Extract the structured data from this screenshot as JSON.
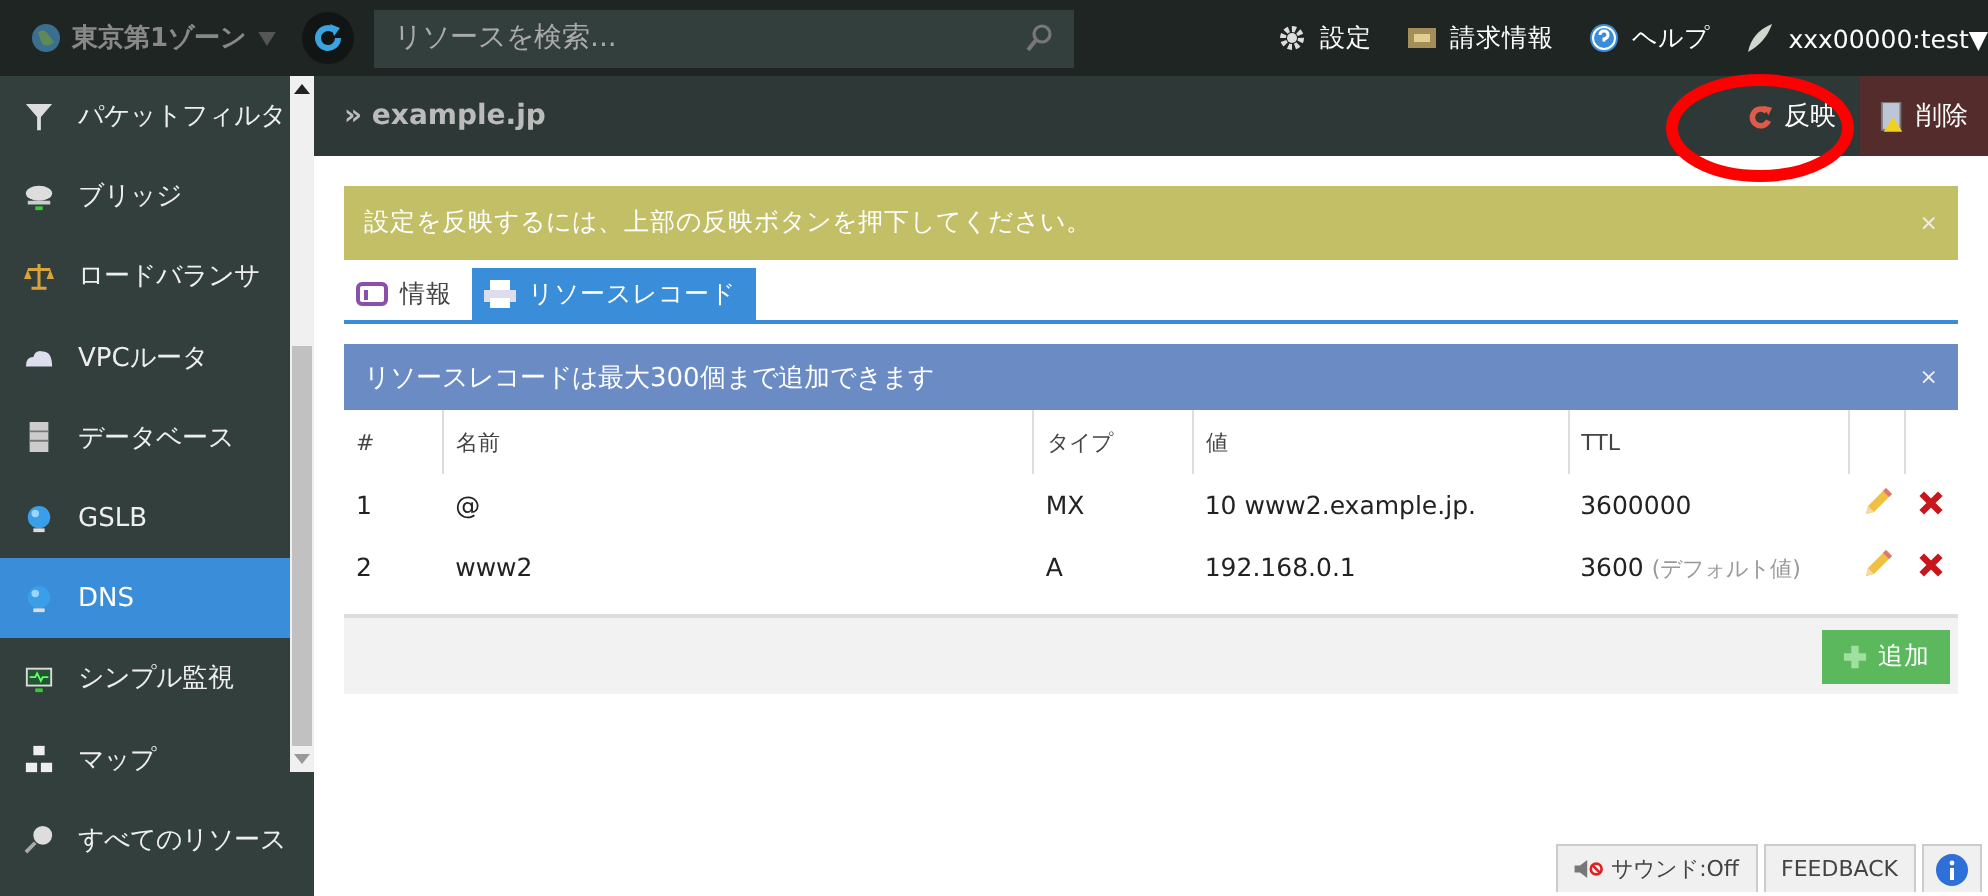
{
  "topbar": {
    "zone": "東京第1ゾーン",
    "search": {
      "placeholder": "リソースを検索..."
    },
    "links": [
      {
        "kind": "gear",
        "label": "設定"
      },
      {
        "kind": "bill",
        "label": "請求情報"
      },
      {
        "kind": "help",
        "label": "ヘルプ"
      },
      {
        "kind": "user",
        "label": "xxx00000:test▼"
      }
    ]
  },
  "sidebar": {
    "items": [
      {
        "kind": "filter",
        "label": "パケットフィルタ",
        "selected": false
      },
      {
        "kind": "bridge",
        "label": "ブリッジ",
        "selected": false
      },
      {
        "kind": "scale",
        "label": "ロードバランサ",
        "selected": false
      },
      {
        "kind": "cloud",
        "label": "VPCルータ",
        "selected": false
      },
      {
        "kind": "db",
        "label": "データベース",
        "selected": false
      },
      {
        "kind": "globe",
        "label": "GSLB",
        "selected": false
      },
      {
        "kind": "globe",
        "label": "DNS",
        "selected": true
      },
      {
        "kind": "monitor",
        "label": "シンプル監視",
        "selected": false
      },
      {
        "kind": "map",
        "label": "マップ",
        "selected": false
      },
      {
        "kind": "search",
        "label": "すべてのリソース",
        "selected": false
      }
    ]
  },
  "header": {
    "breadcrumb": "» example.jp",
    "actions": [
      {
        "kind": "apply",
        "label": "反映",
        "highlighted": true
      },
      {
        "kind": "delete",
        "label": "削除",
        "highlighted": false
      }
    ]
  },
  "alert": {
    "text": "設定を反映するには、上部の反映ボタンを押下してください。",
    "close": "×"
  },
  "tabs": [
    {
      "kind": "info",
      "label": "情報",
      "selected": false
    },
    {
      "kind": "records",
      "label": "リソースレコード",
      "selected": true
    }
  ],
  "notice": {
    "text": "リソースレコードは最大300個まで追加できます",
    "close": "×"
  },
  "table": {
    "columns": [
      "#",
      "名前",
      "タイプ",
      "値",
      "TTL"
    ],
    "rows": [
      {
        "cells": [
          "1",
          "@",
          "MX",
          "10 www2.example.jp.",
          "3600000"
        ]
      },
      {
        "cells": [
          "2",
          "www2",
          "A",
          "192.168.0.1",
          "3600"
        ],
        "ttl_note": "(デフォルト値)"
      }
    ]
  },
  "add_button": "追加",
  "footer": {
    "sound": "サウンド:Off",
    "feedback": "FEEDBACK"
  }
}
